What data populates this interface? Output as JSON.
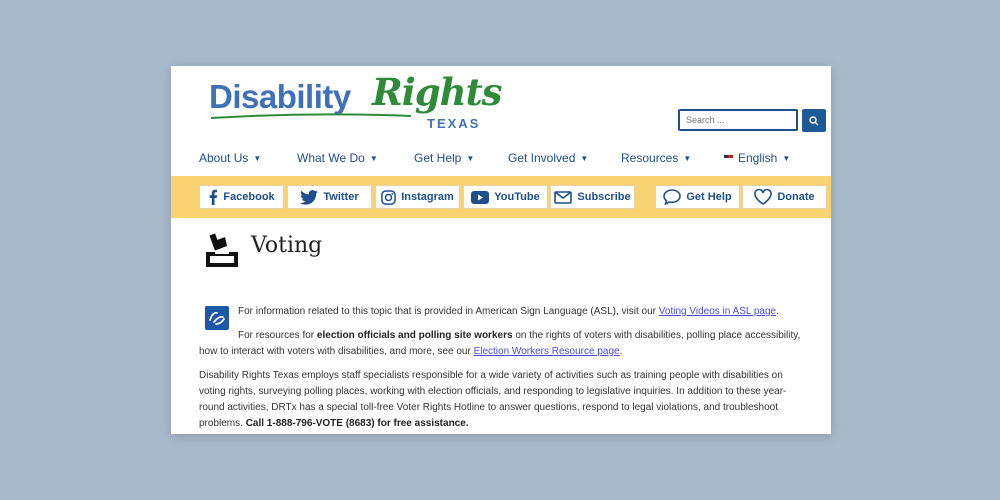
{
  "logo": {
    "part1": "Disability",
    "part2": "Rights",
    "part3": "TEXAS"
  },
  "search": {
    "placeholder": "Search ..."
  },
  "nav": {
    "items": [
      {
        "label": "About Us"
      },
      {
        "label": "What We Do"
      },
      {
        "label": "Get Help"
      },
      {
        "label": "Get Involved"
      },
      {
        "label": "Resources"
      },
      {
        "label": "English"
      }
    ]
  },
  "social": {
    "buttons": [
      {
        "label": "Facebook",
        "icon": "facebook-icon"
      },
      {
        "label": "Twitter",
        "icon": "twitter-icon"
      },
      {
        "label": "Instagram",
        "icon": "instagram-icon"
      },
      {
        "label": "YouTube",
        "icon": "youtube-icon"
      },
      {
        "label": "Subscribe",
        "icon": "envelope-icon"
      },
      {
        "label": "Get Help",
        "icon": "chat-bubble-icon"
      },
      {
        "label": "Donate",
        "icon": "heart-icon"
      }
    ]
  },
  "page": {
    "title": "Voting"
  },
  "content": {
    "asl_text": "For information related to this topic that is provided in American Sign Language (ASL), visit our",
    "asl_link": "Voting Videos in ASL page",
    "resources_text_1": "For resources for",
    "resources_bold": "election officials and polling site workers",
    "resources_text_2": "on the rights of voters with disabilities, polling place accessibility,",
    "resources_text_3": "how to interact with voters with disabilities, and more, see our",
    "resources_link": "Election Workers Resource page",
    "para_line1": "Disability Rights Texas employs staff specialists responsible for a wide variety of activities such as training people with disabilities on",
    "para_line2": "voting rights, surveying polling places, working with election officials, and responding to legislative inquiries. In addition to these year-",
    "para_line3": "round activities, DRTx has a special toll-free Voter Rights Hotline to answer questions, respond to legal violations, and troubleshoot",
    "para_line4_text": "problems.",
    "para_line4_bold": "Call 1-888-796-VOTE (8683) for free assistance."
  },
  "colors": {
    "brand_blue": "#1e4f8a",
    "brand_green": "#2e8b3a",
    "band_yellow": "#f9d272",
    "link": "#4a4ad6"
  }
}
